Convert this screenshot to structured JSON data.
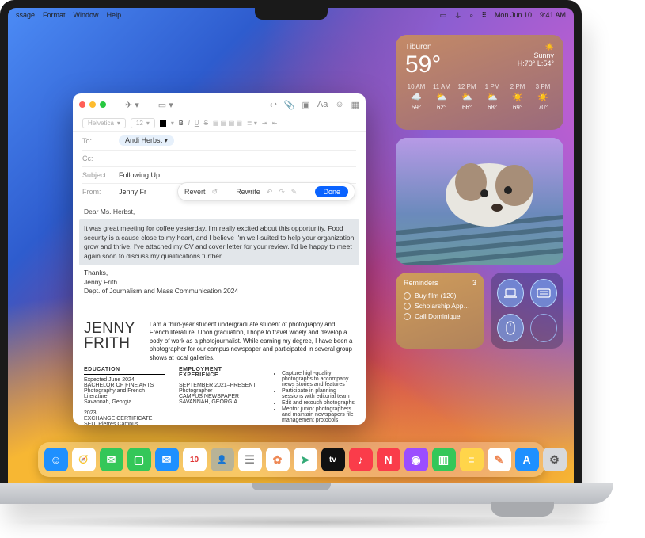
{
  "menubar": {
    "items": [
      "ssage",
      "Format",
      "Window",
      "Help"
    ],
    "date": "Mon Jun 10",
    "time": "9:41 AM"
  },
  "weather": {
    "location": "Tiburon",
    "temp": "59°",
    "condition": "Sunny",
    "hi": "H:70°",
    "lo": "L:54°",
    "hours": [
      {
        "t": "10 AM",
        "ic": "☁️",
        "v": "59°"
      },
      {
        "t": "11 AM",
        "ic": "⛅",
        "v": "62°"
      },
      {
        "t": "12 PM",
        "ic": "⛅",
        "v": "66°"
      },
      {
        "t": "1 PM",
        "ic": "⛅",
        "v": "68°"
      },
      {
        "t": "2 PM",
        "ic": "☀️",
        "v": "69°"
      },
      {
        "t": "3 PM",
        "ic": "☀️",
        "v": "70°"
      }
    ]
  },
  "reminders": {
    "title": "Reminders",
    "count": "3",
    "items": [
      {
        "label": "Buy film (120)"
      },
      {
        "label": "Scholarship App…"
      },
      {
        "label": "Call Dominique"
      }
    ]
  },
  "mail": {
    "font_name": "Helvetica",
    "font_size": "12",
    "to_label": "To:",
    "to_value": "Andi Herbst ",
    "cc_label": "Cc:",
    "subject_label": "Subject:",
    "subject_value": "Following Up",
    "from_label": "From:",
    "from_value": "Jenny Fr",
    "wt_revert": "Revert",
    "wt_rewrite": "Rewrite",
    "wt_done": "Done",
    "greeting": "Dear Ms. Herbst,",
    "para": "It was great meeting for coffee yesterday. I'm really excited about this opportunity. Food security is a cause close to my heart, and I believe I'm well-suited to help your organization grow and thrive. I've attached my CV and cover letter for your review. I'd be happy to meet again soon to discuss my qualifications further.",
    "signoff": "Thanks,",
    "sig1": "Jenny Frith",
    "sig2": "Dept. of Journalism and Mass Communication 2024",
    "resume_name": "JENNY\nFRITH",
    "resume_desc": "I am a third-year student undergraduate student of photography and French literature. Upon graduation, I hope to travel widely and develop a body of work as a photojournalist. While earning my degree, I have been a photographer for our campus newspaper and participated in several group shows at local galleries.",
    "edu_head": "EDUCATION",
    "edu": [
      "Expected June 2024",
      "BACHELOR OF FINE ARTS",
      "Photography and French Literature",
      "Savannah, Georgia",
      "",
      "2023",
      "EXCHANGE CERTIFICATE",
      "SEU, Pierres Campus"
    ],
    "emp_head": "EMPLOYMENT EXPERIENCE",
    "emp": [
      "SEPTEMBER 2021–PRESENT",
      "Photographer",
      "CAMPUS NEWSPAPER",
      "SAVANNAH, GEORGIA"
    ],
    "bullets": [
      "Capture high-quality photographs to accompany news stories and features",
      "Participate in planning sessions with editorial team",
      "Edit and retouch photographs",
      "Mentor junior photographers and maintain newspapers file management protocols"
    ]
  },
  "dock": {
    "apps": [
      {
        "n": "finder",
        "c": "#1e90ff",
        "g": "☺"
      },
      {
        "n": "safari",
        "c": "#fff",
        "g": "🧭"
      },
      {
        "n": "messages",
        "c": "#34c759",
        "g": "✉"
      },
      {
        "n": "facetime",
        "c": "#34c759",
        "g": "▢"
      },
      {
        "n": "mail",
        "c": "#1e90ff",
        "g": "✉"
      },
      {
        "n": "calendar",
        "c": "#fff",
        "g": "10",
        "tc": "#e03131"
      },
      {
        "n": "contacts",
        "c": "#b8b397",
        "g": "👤"
      },
      {
        "n": "reminders",
        "c": "#fff",
        "g": "☰",
        "tc": "#888"
      },
      {
        "n": "photos",
        "c": "#fff",
        "g": "✿",
        "tc": "#e85"
      },
      {
        "n": "maps",
        "c": "#fff",
        "g": "➤",
        "tc": "#3a7"
      },
      {
        "n": "tv",
        "c": "#111",
        "g": "tv"
      },
      {
        "n": "music",
        "c": "#fa3c4a",
        "g": "♪"
      },
      {
        "n": "news",
        "c": "#fa3c4a",
        "g": "N"
      },
      {
        "n": "podcasts",
        "c": "#9b4dff",
        "g": "◉"
      },
      {
        "n": "numbers",
        "c": "#34c759",
        "g": "▥"
      },
      {
        "n": "notes",
        "c": "#ffd54a",
        "g": "≡"
      },
      {
        "n": "freeform",
        "c": "#fff",
        "g": "✎",
        "tc": "#e85"
      },
      {
        "n": "appstore",
        "c": "#1e90ff",
        "g": "A"
      },
      {
        "n": "settings",
        "c": "#d7d9dc",
        "g": "⚙",
        "tc": "#555"
      }
    ]
  }
}
